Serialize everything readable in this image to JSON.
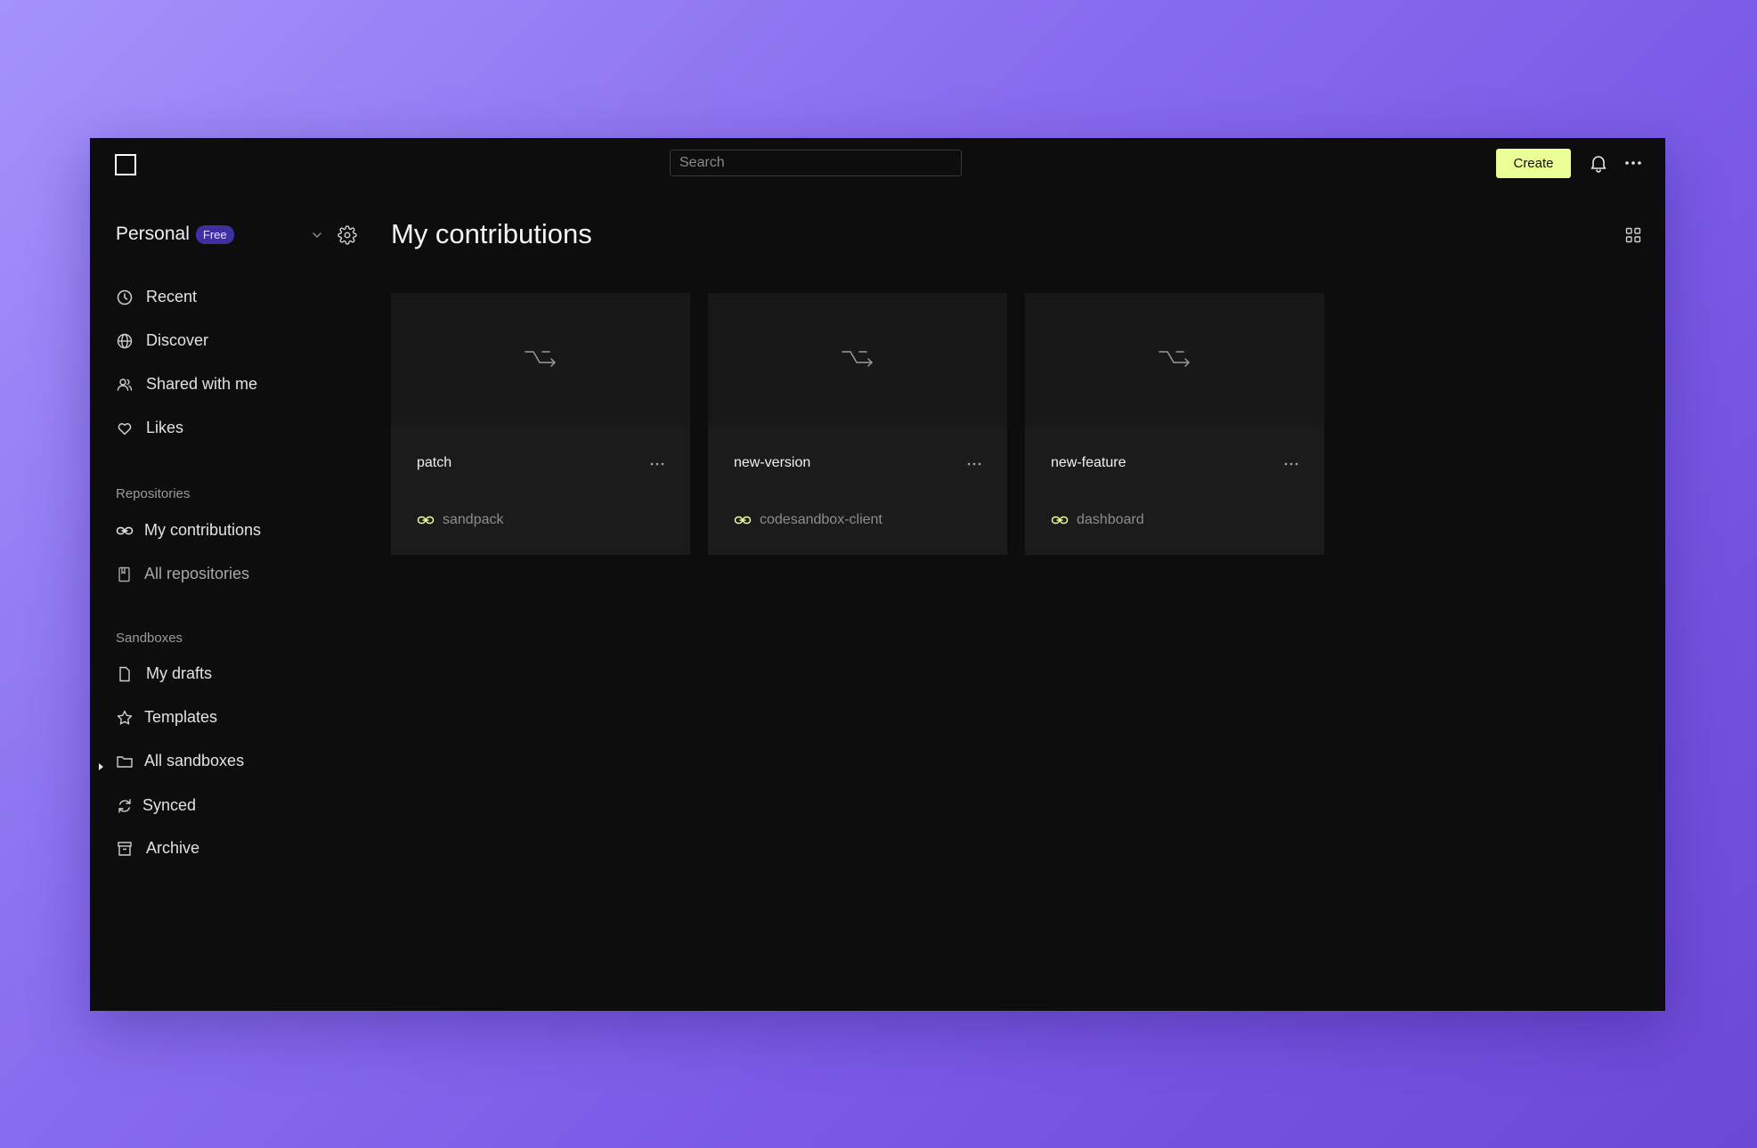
{
  "topbar": {
    "search_placeholder": "Search",
    "create_label": "Create",
    "icons": [
      "logo-icon",
      "bell-icon",
      "more-icon"
    ]
  },
  "sidebar": {
    "workspace_name": "Personal",
    "plan_badge": "Free",
    "nav": [
      {
        "label": "Recent",
        "icon": "clock-icon"
      },
      {
        "label": "Discover",
        "icon": "globe-icon"
      },
      {
        "label": "Shared with me",
        "icon": "users-icon"
      },
      {
        "label": "Likes",
        "icon": "heart-icon"
      }
    ],
    "repositories_label": "Repositories",
    "repositories": [
      {
        "label": "My contributions",
        "icon": "link-icon",
        "active": true
      },
      {
        "label": "All repositories",
        "icon": "book-icon"
      }
    ],
    "sandboxes_label": "Sandboxes",
    "sandboxes": [
      {
        "label": "My drafts",
        "icon": "file-icon"
      },
      {
        "label": "Templates",
        "icon": "star-icon"
      },
      {
        "label": "All sandboxes",
        "icon": "folder-icon"
      },
      {
        "label": "Synced",
        "icon": "sync-icon"
      },
      {
        "label": "Archive",
        "icon": "archive-icon"
      }
    ]
  },
  "main": {
    "title": "My contributions",
    "cards": [
      {
        "branch": "patch",
        "repo": "sandpack"
      },
      {
        "branch": "new-version",
        "repo": "codesandbox-client"
      },
      {
        "branch": "new-feature",
        "repo": "dashboard"
      }
    ]
  },
  "colors": {
    "accent": "#eaff96",
    "badge_bg": "#3e2fa3",
    "app_bg": "#0d0d0d",
    "card_bg": "#1b1b1b"
  }
}
